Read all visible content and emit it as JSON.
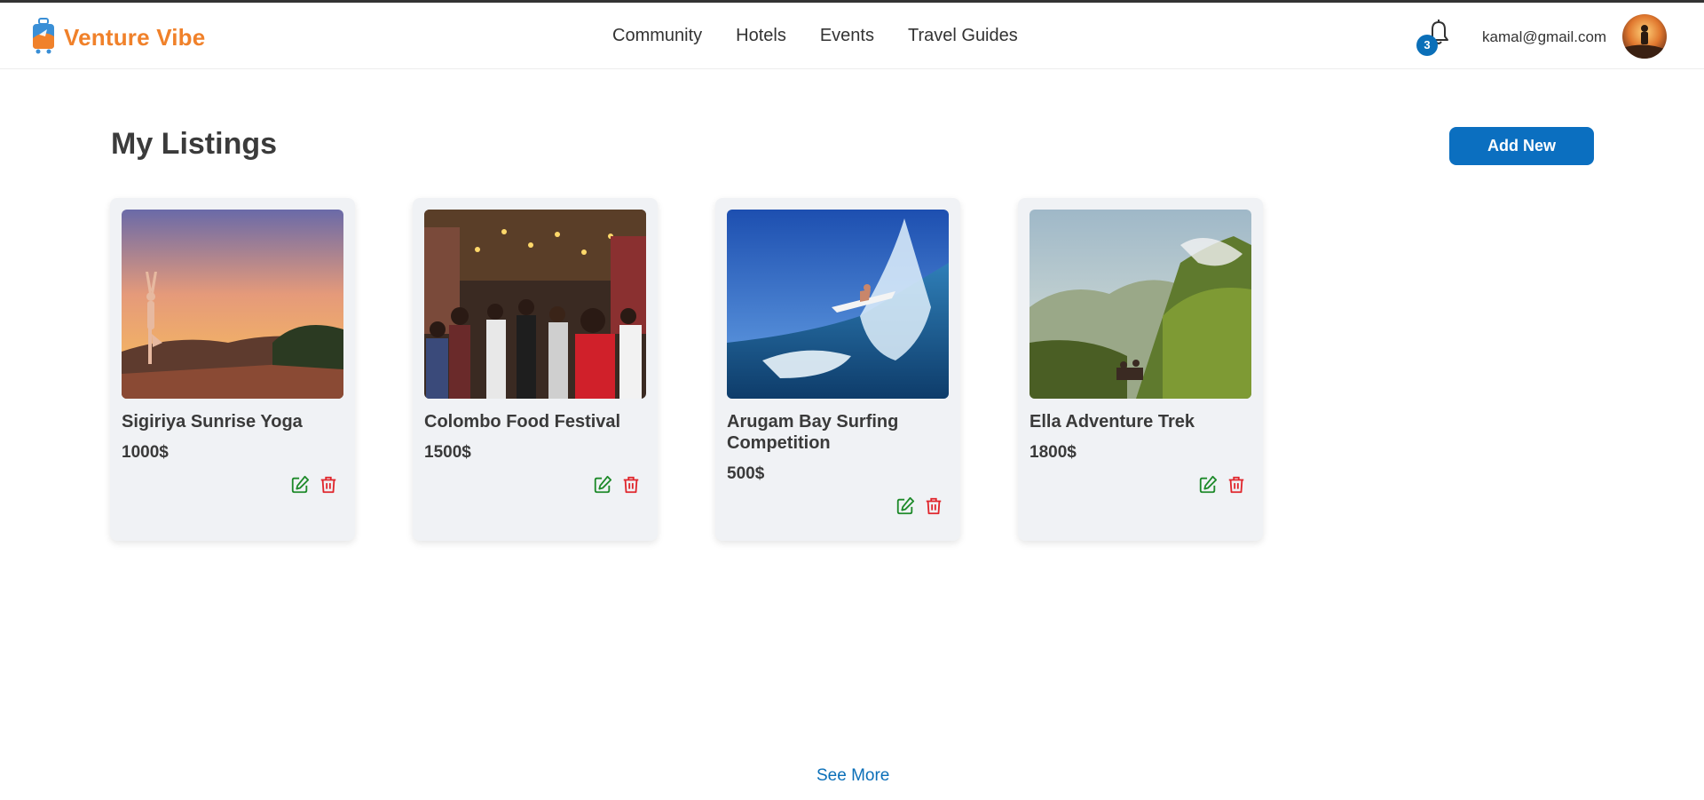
{
  "header": {
    "brand": "Venture Vibe",
    "nav": [
      "Community",
      "Hotels",
      "Events",
      "Travel Guides"
    ],
    "notification_count": "3",
    "user_email": "kamal@gmail.com"
  },
  "main": {
    "title": "My Listings",
    "add_button": "Add New",
    "listings": [
      {
        "title": "Sigiriya Sunrise Yoga",
        "price": "1000$"
      },
      {
        "title": "Colombo Food Festival",
        "price": "1500$"
      },
      {
        "title": "Arugam Bay Surfing Competition",
        "price": "500$"
      },
      {
        "title": "Ella Adventure Trek",
        "price": "1800$"
      }
    ],
    "see_more": "See More"
  },
  "colors": {
    "brand": "#f0812a",
    "primary": "#0b6fc0",
    "edit": "#1e8a2a",
    "delete": "#e0262c"
  }
}
